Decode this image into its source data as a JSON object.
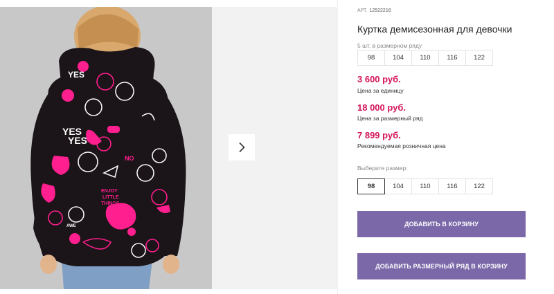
{
  "colors": {
    "price": "#d4145a",
    "button_bg": "#7a68a8",
    "jacket": "#1b1418",
    "pattern_pink": "#ff1f8e"
  },
  "gallery": {
    "next_icon": "chevron-right-icon"
  },
  "product": {
    "sku_label": "АРТ.",
    "sku": "12522216",
    "title": "Куртка демисезонная для девочки",
    "size_row_label": "5 шт. в размерном ряду",
    "size_row": [
      "98",
      "104",
      "110",
      "116",
      "122"
    ],
    "unit_price": "3 600 руб.",
    "unit_price_label": "Цена за единицу",
    "row_price": "18 000 руб.",
    "row_price_label": "Цена за размерный ряд",
    "rrp": "7 899 руб.",
    "rrp_label": "Рекомендуемая розничная цена",
    "choose_size_label": "Выберите размер:",
    "sizes": [
      "98",
      "104",
      "110",
      "116",
      "122"
    ],
    "selected_size": "98",
    "add_to_cart": "ДОБАВИТЬ В КОРЗИНУ",
    "add_row_to_cart": "ДОБАВИТЬ РАЗМЕРНЫЙ РЯД В КОРЗИНУ"
  }
}
